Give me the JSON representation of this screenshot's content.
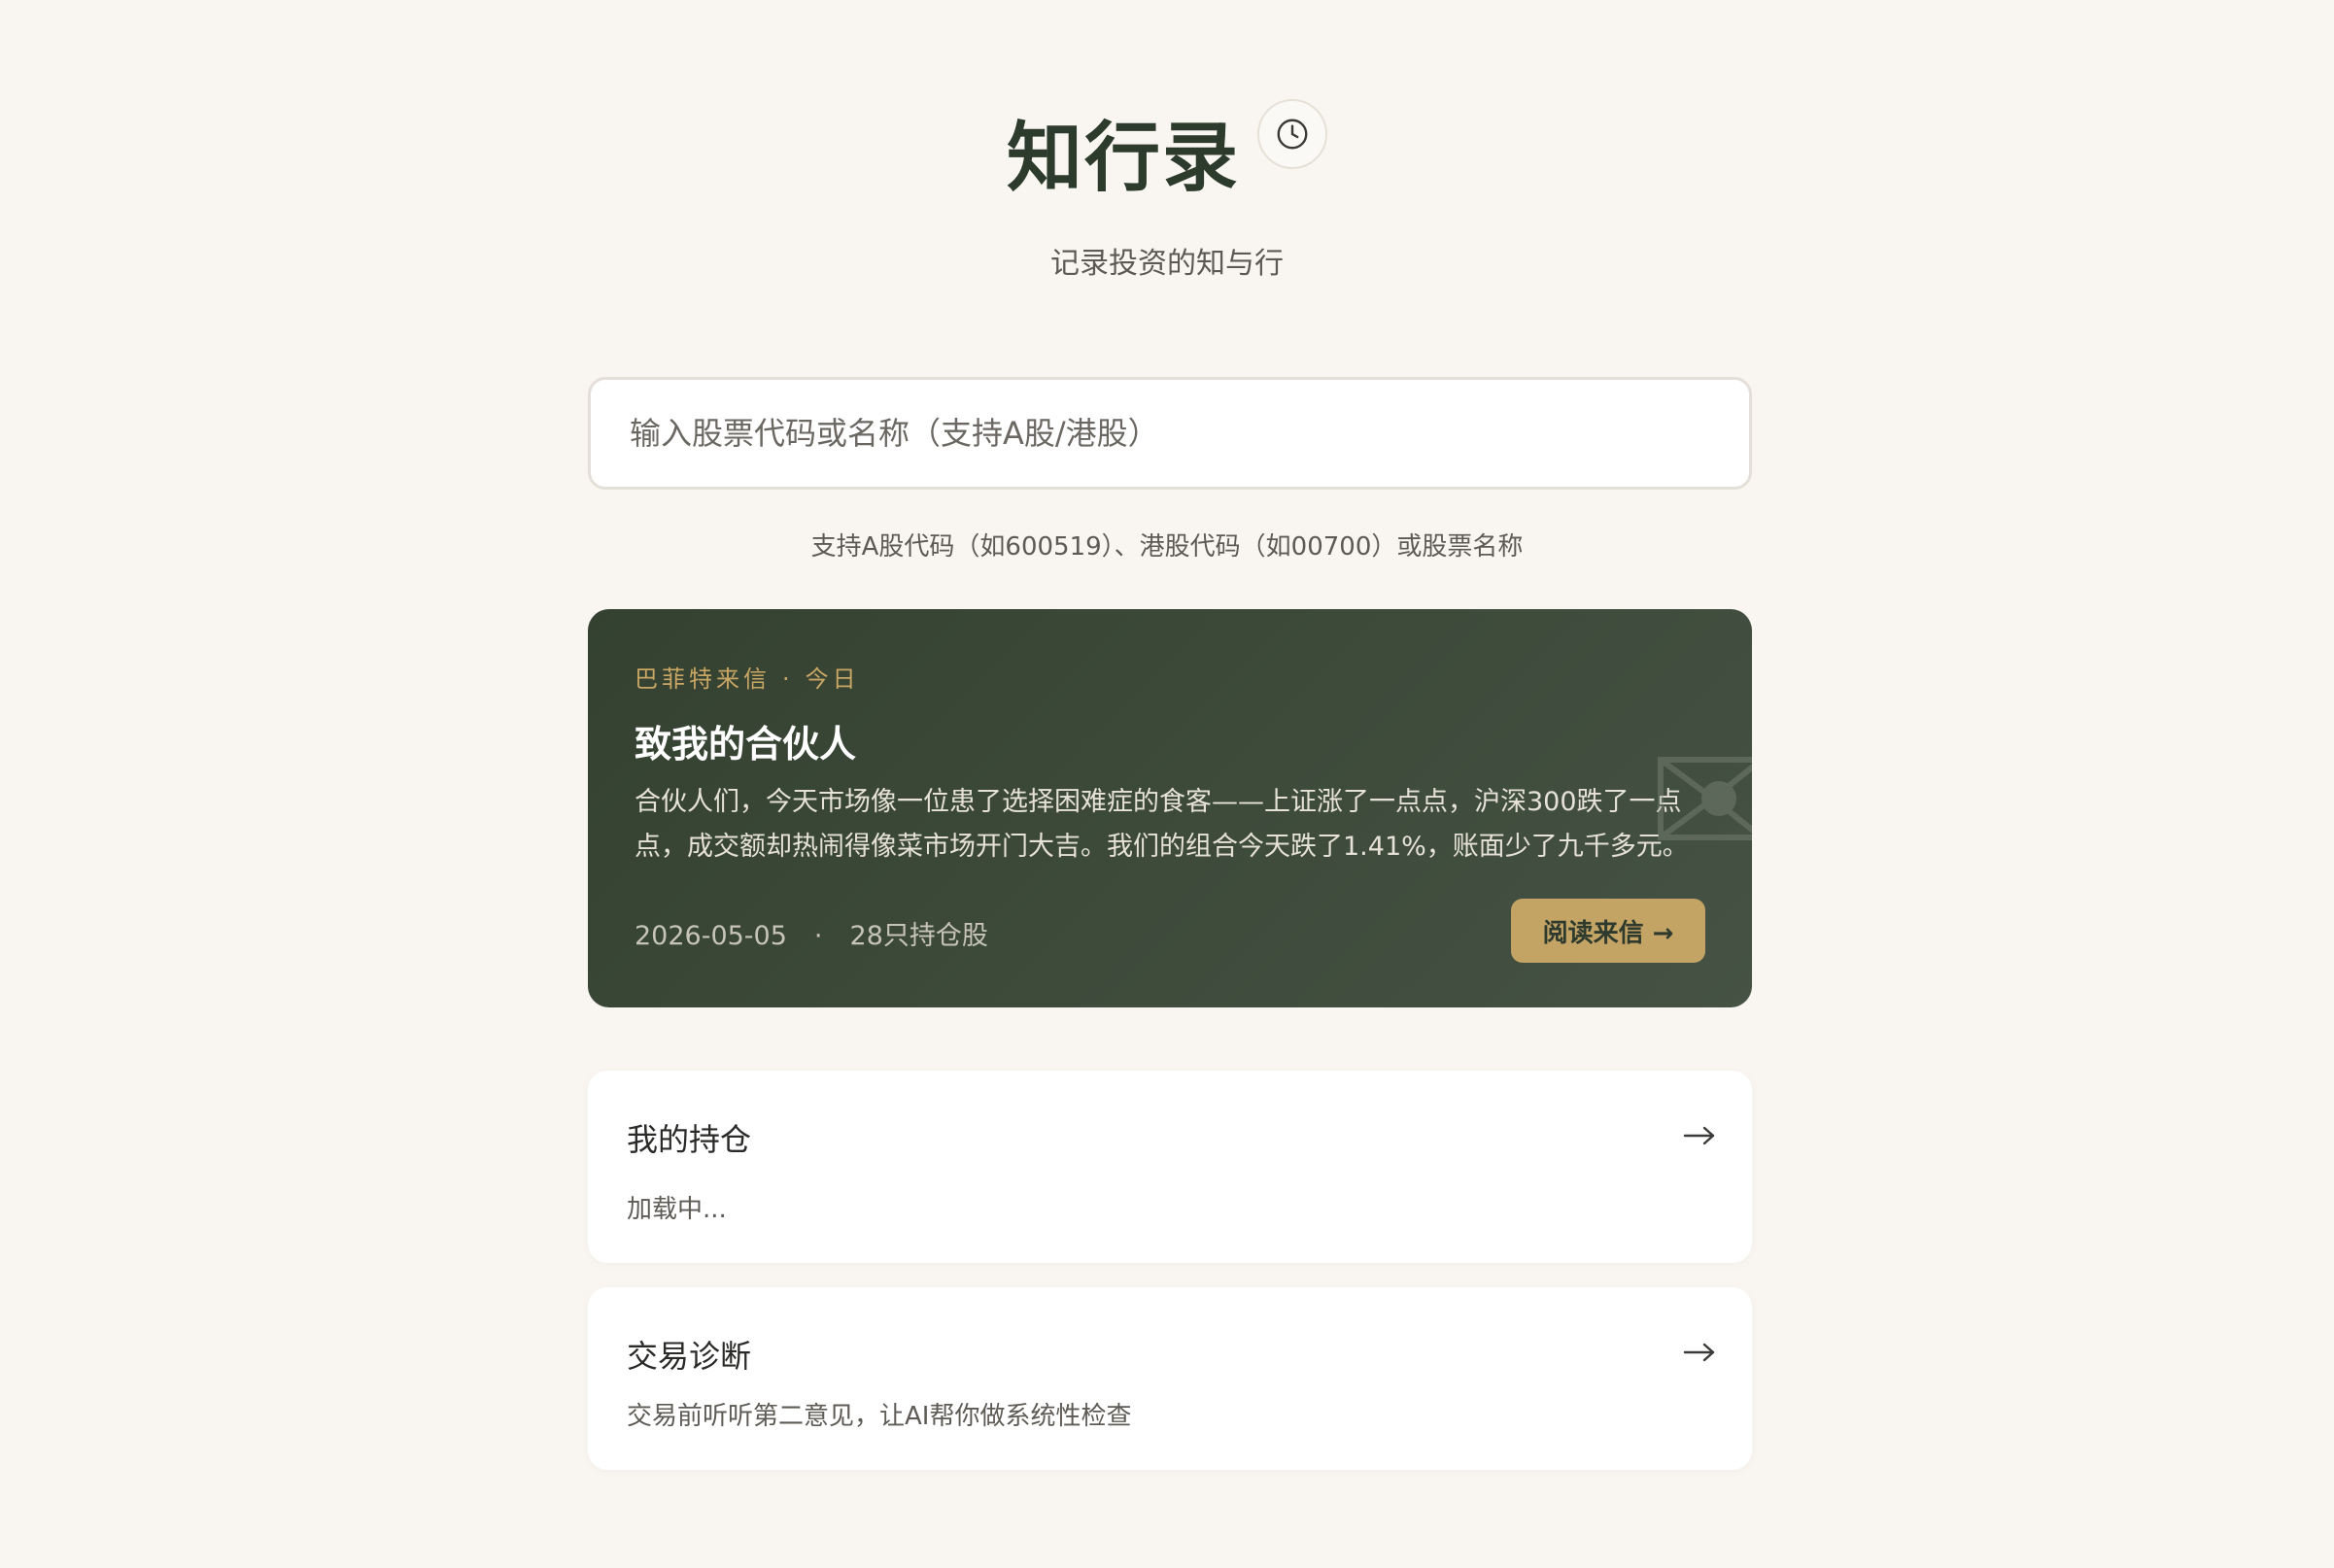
{
  "header": {
    "title": "知行录",
    "subtitle": "记录投资的知与行",
    "history_icon": "clock-icon"
  },
  "search": {
    "placeholder": "输入股票代码或名称（支持A股/港股）",
    "value": "",
    "hint": "支持A股代码（如600519）、港股代码（如00700）或股票名称"
  },
  "letter": {
    "source": "巴菲特来信",
    "dot": "·",
    "when": "今日",
    "title": "致我的合伙人",
    "body": "合伙人们，今天市场像一位患了选择困难症的食客——上证涨了一点点，沪深300跌了一点点，成交额却热闹得像菜市场开门大吉。我们的组合今天跌了1.41%，账面少了九千多元。",
    "date": "2026-05-05",
    "holdings": "28只持仓股",
    "read_button": "阅读来信 →",
    "icon": "envelope-icon",
    "colors": {
      "background": "#3a4737",
      "accent": "#c4a465"
    }
  },
  "cards": {
    "portfolio": {
      "title": "我的持仓",
      "status": "加载中...",
      "arrow": "arrow-right-icon"
    },
    "diagnosis": {
      "title": "交易诊断",
      "description": "交易前听听第二意见，让AI帮你做系统性检查",
      "arrow": "arrow-right-icon"
    }
  },
  "colors": {
    "page_background": "#f9f6f1",
    "title": "#2d3b2c",
    "gold": "#c4a465"
  }
}
